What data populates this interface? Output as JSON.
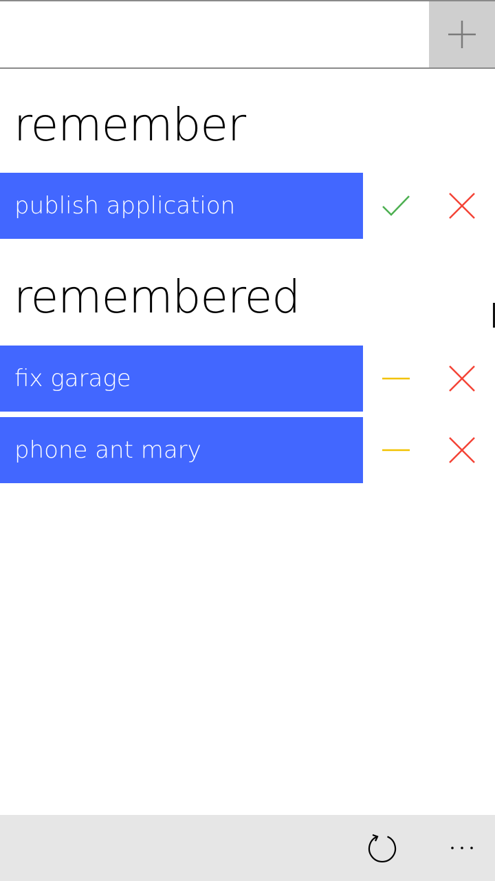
{
  "new_item": {
    "value": "",
    "placeholder": "",
    "add_icon": "plus-icon"
  },
  "sections": {
    "remember": {
      "heading": "remember",
      "items": [
        {
          "label": "publish application",
          "action_icon": "checkmark-icon",
          "delete_icon": "close-icon"
        }
      ]
    },
    "remembered": {
      "heading": "remembered",
      "items": [
        {
          "label": "fix garage",
          "action_icon": "minus-icon",
          "delete_icon": "close-icon"
        },
        {
          "label": "phone ant mary",
          "action_icon": "minus-icon",
          "delete_icon": "close-icon"
        }
      ]
    }
  },
  "app_bar": {
    "refresh_icon": "refresh-icon",
    "more_icon": "more-icon"
  },
  "colors": {
    "item_background": "#4267ff",
    "check": "#4caf50",
    "minus": "#f2c200",
    "delete": "#f44336",
    "add_button_background": "#cfcfcf",
    "app_bar_background": "#e6e6e6"
  }
}
